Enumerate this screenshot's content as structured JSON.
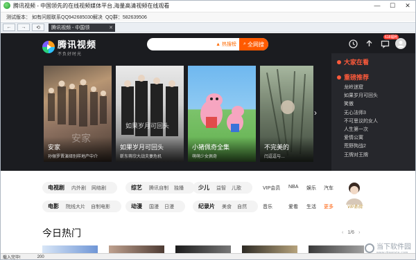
{
  "window": {
    "title": "腾讯视频 - 中国领先的在线视频媒体平台,海量高清视频在线观看",
    "min_label": "—",
    "max_label": "☐",
    "close_label": "✕"
  },
  "infobar": {
    "version": "测试版本：",
    "qq_group": "如有问题联系QQ942685030解决",
    "qq_label": "QQ群：582639506"
  },
  "nav": {
    "back": "←",
    "forward": "→",
    "refresh": "⟲",
    "tab_title": "腾讯视频 - 中国领",
    "tab_close": "✕"
  },
  "site": {
    "logo_main": "腾讯视频",
    "logo_sub": "不负好时光",
    "search": {
      "placeholder": "",
      "hot_label": "热搜榜",
      "button_label": "全网搜"
    },
    "badge_text": "618福利",
    "cards": [
      {
        "title": "安家",
        "subtitle": "孙俪罗晋演绎别样地产中介",
        "overlay": "安家"
      },
      {
        "title": "如果岁月可回头",
        "subtitle": "靳东蒋欣大战夫妻危机",
        "overlay": "如果岁月可回头"
      },
      {
        "title": "小猪佩奇全集",
        "subtitle": "萌萌少女佩奇",
        "overlay": ""
      },
      {
        "title": "不完美的",
        "subtitle": "闫逗逗与…",
        "overlay": ""
      }
    ],
    "next_arrow": "›",
    "right_panel": {
      "title": "大家在看",
      "section": "重磅推荐",
      "items": [
        "龙岭迷窟",
        "如果岁月可回头",
        "笑傲",
        "无心法师3",
        "不可思议的女人",
        "人生第一次",
        "爱情公寓",
        "荒野狗战2",
        "王牌对王牌"
      ]
    },
    "categories": {
      "row1": [
        {
          "main": "电视剧",
          "subs": [
            "内外剧",
            "网络剧"
          ]
        },
        {
          "main": "综艺",
          "subs": [
            "腾讯自制",
            "独播"
          ]
        },
        {
          "main": "少儿",
          "subs": [
            "益智",
            "儿歌"
          ]
        }
      ],
      "row2": [
        {
          "main": "电影",
          "subs": [
            "院线大片",
            "自制电影"
          ]
        },
        {
          "main": "动漫",
          "subs": [
            "国漫",
            "日漫"
          ]
        },
        {
          "main": "纪录片",
          "subs": [
            "美食",
            "自然"
          ]
        }
      ],
      "extra_row1": [
        "VIP会员",
        "NBA",
        "娱乐",
        "汽车"
      ],
      "extra_row2": [
        "音乐",
        "爱看",
        "生活",
        "更多"
      ],
      "vip_tag": "VIP影院"
    },
    "today_title": "今日热门",
    "pager": {
      "prev": "‹",
      "text": "1/6",
      "next": "›"
    }
  },
  "statusbar": {
    "status": "载入完毕!",
    "code": "200"
  },
  "watermark": {
    "text": "当下软件园",
    "sub": "www.downxia.com"
  },
  "colors": {
    "accent": "#ff5a00",
    "panel_red": "#ff5a3b",
    "dark_bg": "#1b1c20"
  }
}
